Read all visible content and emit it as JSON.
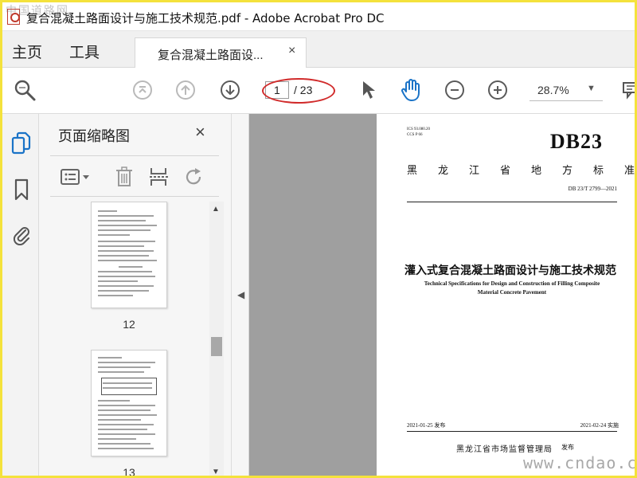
{
  "window": {
    "title": "复合混凝土路面设计与施工技术规范.pdf - Adobe Acrobat Pro DC",
    "watermark_top": "中国道路网",
    "watermark_bottom": "www.cndao.com"
  },
  "tabs": {
    "home": "主页",
    "tools": "工具",
    "document": "复合混凝土路面设...",
    "close_symbol": "×"
  },
  "toolbar": {
    "current_page": "1",
    "total_pages": "/ 23",
    "zoom": "28.7%"
  },
  "panel": {
    "title": "页面缩略图",
    "close_symbol": "×",
    "thumbnails": [
      {
        "label": "12"
      },
      {
        "label": "13"
      }
    ]
  },
  "page": {
    "ics": "ICS 93.080.20",
    "ccs": "CCS P 66",
    "db_mark": "DB23",
    "standard_type": "黑龙江省地方标准",
    "code": "DB 23/T 2799—2021",
    "title_zh": "灌入式复合混凝土路面设计与施工技术规范",
    "title_en_line1": "Technical Specifications for Design and Construction of Filling Composite",
    "title_en_line2": "Material Concrete Pavement",
    "issue_date": "2021-01-25 发布",
    "impl_date": "2021-02-24 实施",
    "issuer": "黑龙江省市场监督管理局",
    "publish_word": "发布"
  },
  "colors": {
    "accent_blue": "#1a73c7",
    "annotation_red": "#d12b2b",
    "frame_yellow": "#f4e23c",
    "doc_background": "#9f9f9f"
  },
  "icons": {
    "search": "magnifier-icon",
    "first_page": "first-page-icon",
    "prev_page": "arrow-up-icon",
    "next_page": "arrow-down-icon",
    "select": "cursor-arrow-icon",
    "hand": "hand-icon",
    "zoom_out": "minus-circle-icon",
    "zoom_in": "plus-circle-icon"
  }
}
